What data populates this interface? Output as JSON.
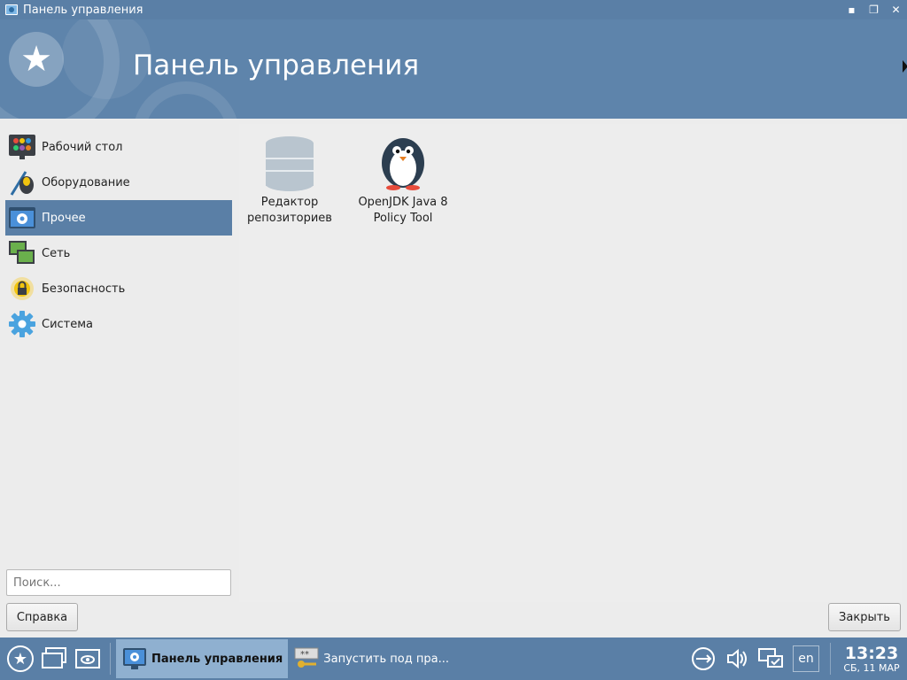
{
  "window": {
    "title": "Панель управления",
    "buttons": {
      "minimize": "▪",
      "maximize": "❐",
      "close": "✕"
    }
  },
  "banner": {
    "heading": "Панель управления"
  },
  "sidebar": {
    "items": [
      {
        "label": "Рабочий стол",
        "icon": "desktop-palette-icon",
        "active": false
      },
      {
        "label": "Оборудование",
        "icon": "hardware-mouse-icon",
        "active": false
      },
      {
        "label": "Прочее",
        "icon": "other-gear-icon",
        "active": true
      },
      {
        "label": "Сеть",
        "icon": "network-monitors-icon",
        "active": false
      },
      {
        "label": "Безопасность",
        "icon": "security-lock-icon",
        "active": false
      },
      {
        "label": "Система",
        "icon": "system-gear-icon",
        "active": false
      }
    ]
  },
  "content": {
    "items": [
      {
        "label": "Редактор\nрепозиториев",
        "icon": "database-icon"
      },
      {
        "label": "OpenJDK Java 8\nPolicy Tool",
        "icon": "penguin-icon"
      }
    ]
  },
  "search": {
    "placeholder": "Поиск..."
  },
  "footer": {
    "help_label": "Справка",
    "close_label": "Закрыть"
  },
  "taskbar": {
    "tasks": [
      {
        "label": "Панель управления",
        "active": true
      },
      {
        "label": "Запустить под пра...",
        "active": false
      }
    ],
    "lang": "en",
    "time": "13:23",
    "date": "СБ, 11 МАР"
  },
  "colors": {
    "accent": "#5a7fa6",
    "banner": "#5e84ab",
    "background": "#ececec"
  }
}
